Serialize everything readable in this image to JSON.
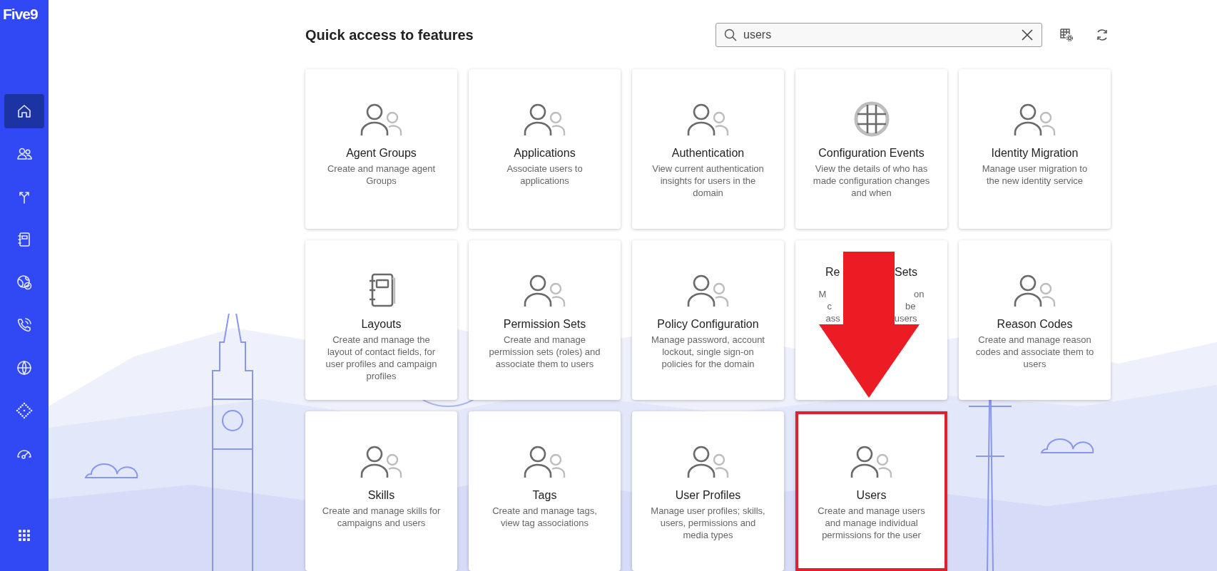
{
  "sidebar": {
    "logo": "Five9",
    "items": [
      {
        "kind": "home",
        "selected": true
      },
      {
        "kind": "users",
        "selected": false
      },
      {
        "kind": "split",
        "selected": false
      },
      {
        "kind": "notebook",
        "selected": false
      },
      {
        "kind": "globe-check",
        "selected": false
      },
      {
        "kind": "phone",
        "selected": false
      },
      {
        "kind": "globe",
        "selected": false
      },
      {
        "kind": "diamond",
        "selected": false
      },
      {
        "kind": "gauge",
        "selected": false
      }
    ],
    "bottom": {
      "kind": "grid"
    }
  },
  "header": {
    "title": "Quick access to features",
    "search": {
      "value": "users"
    }
  },
  "cards": [
    {
      "kind": "users",
      "title": "Agent Groups",
      "description": "Create and manage agent Groups",
      "highlighted": false
    },
    {
      "kind": "users",
      "title": "Applications",
      "description": "Associate users to applications",
      "highlighted": false
    },
    {
      "kind": "users",
      "title": "Authentication",
      "description": "View current authentication insights for users in the domain",
      "highlighted": false
    },
    {
      "kind": "globe",
      "title": "Configuration Events",
      "description": "View the details of who has made configuration changes and when",
      "highlighted": false
    },
    {
      "kind": "users",
      "title": "Identity Migration",
      "description": "Manage user migration to the new identity service",
      "highlighted": false
    },
    {
      "kind": "notebook",
      "title": "Layouts",
      "description": "Create and manage the layout of contact fields, for user profiles and campaign profiles",
      "highlighted": false
    },
    {
      "kind": "users",
      "title": "Permission Sets",
      "description": "Create and manage permission sets (roles) and associate them to users",
      "highlighted": false
    },
    {
      "kind": "users",
      "title": "Policy Configuration",
      "description": "Manage password, account lockout, single sign-on policies for the domain",
      "highlighted": false
    },
    {
      "title_parts": [
        "Re",
        "Sets"
      ],
      "description_parts": [
        [
          "M",
          "on"
        ],
        [
          "c",
          "be"
        ],
        [
          "ass",
          "users"
        ]
      ],
      "highlighted": false
    },
    {
      "kind": "users",
      "title": "Reason Codes",
      "description": "Create and manage reason codes and associate them to users",
      "highlighted": false
    },
    {
      "kind": "users",
      "title": "Skills",
      "description": "Create and manage skills for campaigns and users",
      "highlighted": false
    },
    {
      "kind": "users",
      "title": "Tags",
      "description": "Create and manage tags, view tag associations",
      "highlighted": false
    },
    {
      "kind": "users",
      "title": "User Profiles",
      "description": "Manage user profiles; skills, users, permissions and media types",
      "highlighted": false
    },
    {
      "kind": "users",
      "title": "Users",
      "description": "Create and manage users and manage individual permissions for the user",
      "highlighted": true
    }
  ],
  "annotations": [
    {
      "kind": "arrow"
    }
  ]
}
